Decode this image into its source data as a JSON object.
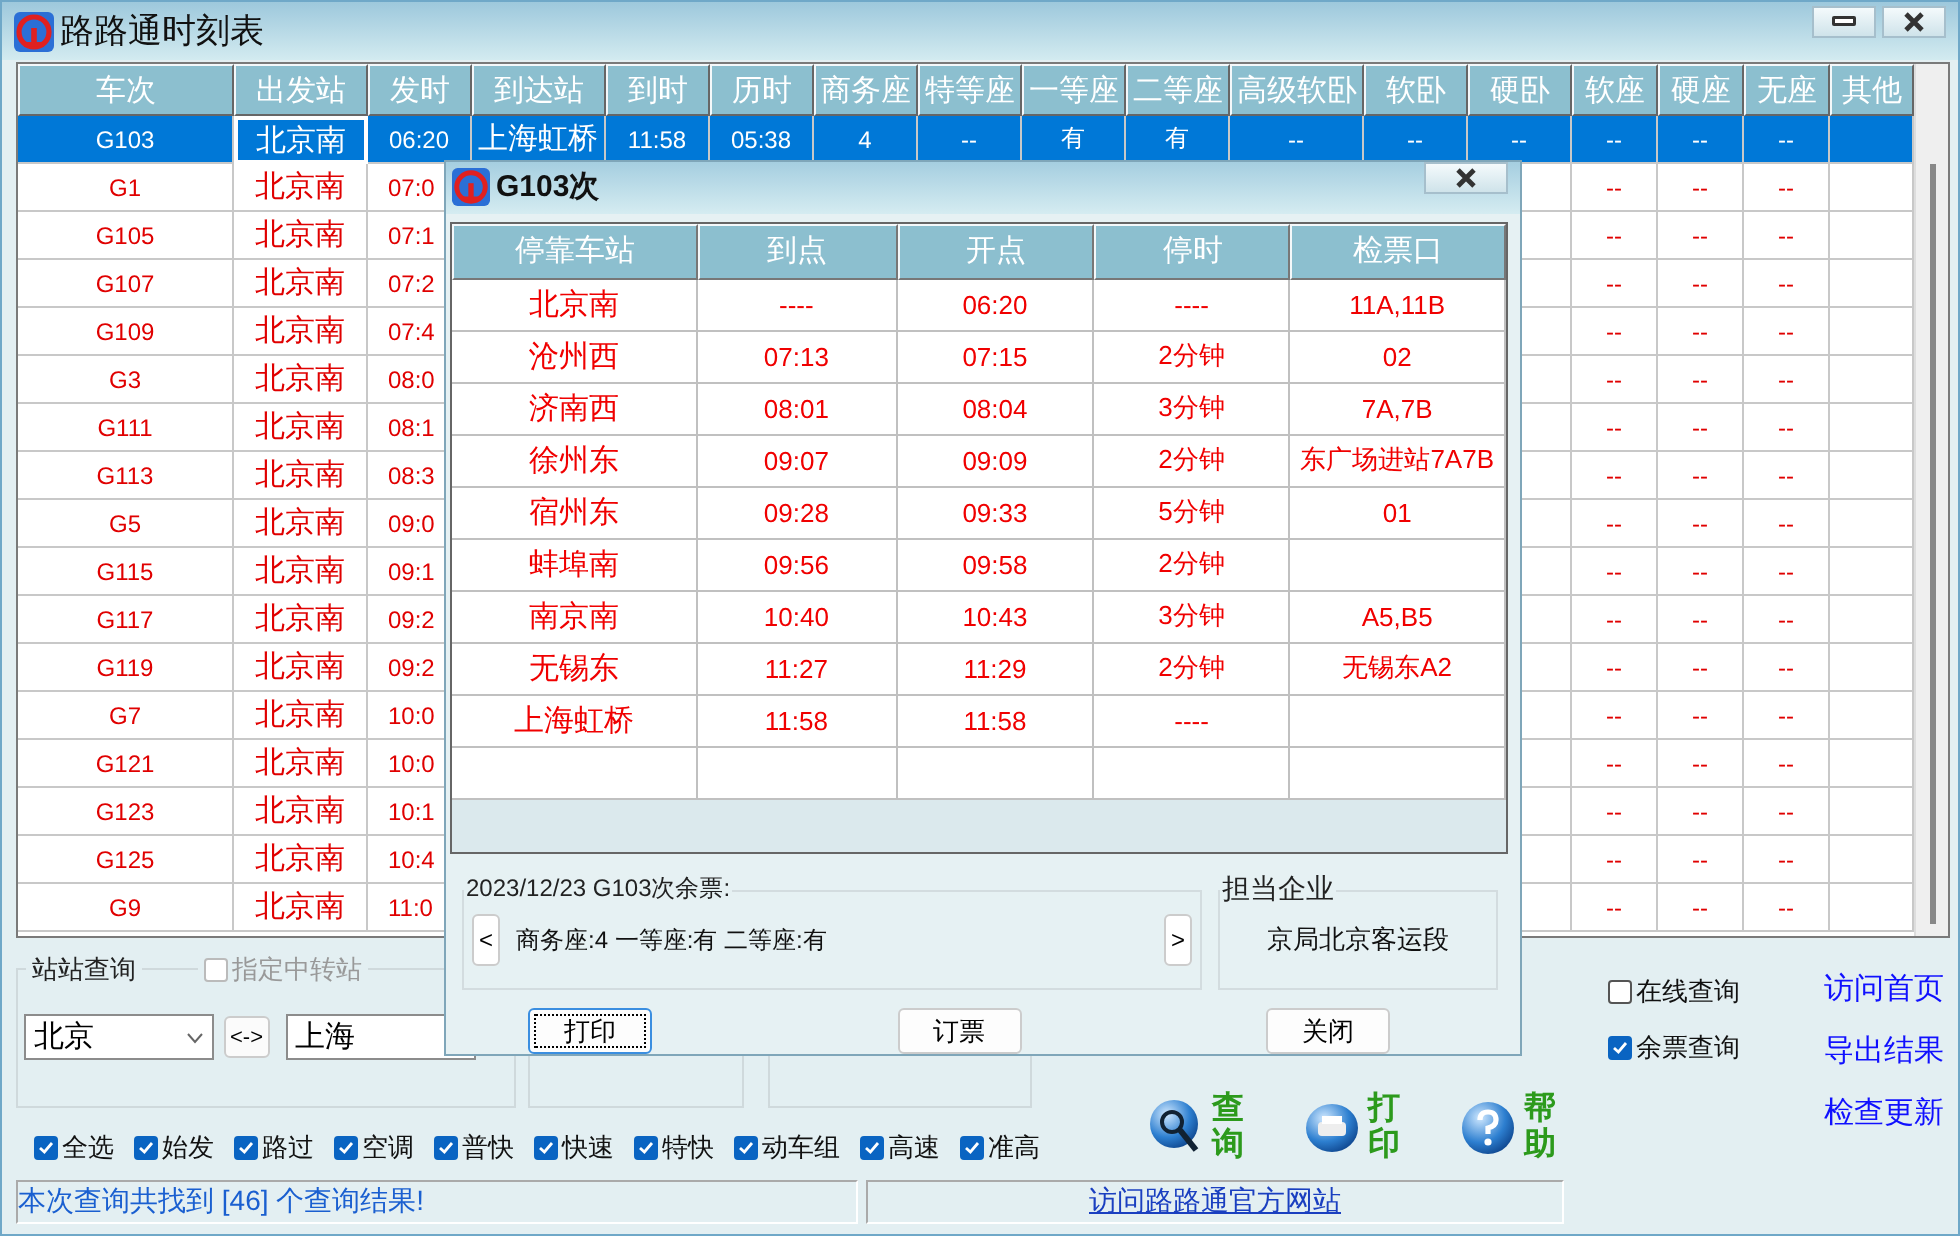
{
  "window": {
    "title": "路路通时刻表",
    "buttons": [
      {
        "kind": "minimize"
      },
      {
        "kind": "close"
      }
    ]
  },
  "table": {
    "columns": [
      "车次",
      "出发站",
      "发时",
      "到达站",
      "到时",
      "历时",
      "商务座",
      "特等座",
      "一等座",
      "二等座",
      "高级软卧",
      "软卧",
      "硬卧",
      "软座",
      "硬座",
      "无座",
      "其他"
    ],
    "rows": [
      {
        "selected": true,
        "lead": [
          "G103",
          "北京南",
          "06:20",
          "上海虹桥",
          "11:58",
          "05:38",
          "4",
          "--",
          "有",
          "有",
          "--",
          "--",
          "--"
        ],
        "tail": [
          "--",
          "--",
          "--"
        ]
      },
      {
        "selected": false,
        "lead": [
          "G1",
          "北京南",
          "07:0"
        ],
        "tail": [
          "--",
          "--",
          "--"
        ]
      },
      {
        "selected": false,
        "lead": [
          "G105",
          "北京南",
          "07:1"
        ],
        "tail": [
          "--",
          "--",
          "--"
        ]
      },
      {
        "selected": false,
        "lead": [
          "G107",
          "北京南",
          "07:2"
        ],
        "tail": [
          "--",
          "--",
          "--"
        ]
      },
      {
        "selected": false,
        "lead": [
          "G109",
          "北京南",
          "07:4"
        ],
        "tail": [
          "--",
          "--",
          "--"
        ]
      },
      {
        "selected": false,
        "lead": [
          "G3",
          "北京南",
          "08:0"
        ],
        "tail": [
          "--",
          "--",
          "--"
        ]
      },
      {
        "selected": false,
        "lead": [
          "G111",
          "北京南",
          "08:1"
        ],
        "tail": [
          "--",
          "--",
          "--"
        ]
      },
      {
        "selected": false,
        "lead": [
          "G113",
          "北京南",
          "08:3"
        ],
        "tail": [
          "--",
          "--",
          "--"
        ]
      },
      {
        "selected": false,
        "lead": [
          "G5",
          "北京南",
          "09:0"
        ],
        "tail": [
          "--",
          "--",
          "--"
        ]
      },
      {
        "selected": false,
        "lead": [
          "G115",
          "北京南",
          "09:1"
        ],
        "tail": [
          "--",
          "--",
          "--"
        ]
      },
      {
        "selected": false,
        "lead": [
          "G117",
          "北京南",
          "09:2"
        ],
        "tail": [
          "--",
          "--",
          "--"
        ]
      },
      {
        "selected": false,
        "lead": [
          "G119",
          "北京南",
          "09:2"
        ],
        "tail": [
          "--",
          "--",
          "--"
        ]
      },
      {
        "selected": false,
        "lead": [
          "G7",
          "北京南",
          "10:0"
        ],
        "tail": [
          "--",
          "--",
          "--"
        ]
      },
      {
        "selected": false,
        "lead": [
          "G121",
          "北京南",
          "10:0"
        ],
        "tail": [
          "--",
          "--",
          "--"
        ]
      },
      {
        "selected": false,
        "lead": [
          "G123",
          "北京南",
          "10:1"
        ],
        "tail": [
          "--",
          "--",
          "--"
        ]
      },
      {
        "selected": false,
        "lead": [
          "G125",
          "北京南",
          "10:4"
        ],
        "tail": [
          "--",
          "--",
          "--"
        ]
      },
      {
        "selected": false,
        "lead": [
          "G9",
          "北京南",
          "11:0"
        ],
        "tail": [
          "--",
          "--",
          "--"
        ]
      }
    ]
  },
  "station_query": {
    "title": "站站查询",
    "transfer": {
      "label": "指定中转站",
      "checked": false,
      "disabled": true
    },
    "from": "北京",
    "swap": "<->",
    "to": "上海"
  },
  "filters": [
    {
      "label": "全选",
      "checked": true
    },
    {
      "label": "始发",
      "checked": true
    },
    {
      "label": "路过",
      "checked": true
    },
    {
      "label": "空调",
      "checked": true
    },
    {
      "label": "普快",
      "checked": true
    },
    {
      "label": "快速",
      "checked": true
    },
    {
      "label": "特快",
      "checked": true
    },
    {
      "label": "动车组",
      "checked": true
    },
    {
      "label": "高速",
      "checked": true
    },
    {
      "label": "准高",
      "checked": true
    }
  ],
  "actions": [
    {
      "kind": "search",
      "label": "查询"
    },
    {
      "kind": "print",
      "label": "打印"
    },
    {
      "kind": "help",
      "label": "帮助"
    }
  ],
  "options": [
    {
      "label": "在线查询",
      "checked": false
    },
    {
      "label": "余票查询",
      "checked": true
    }
  ],
  "links": [
    "访问首页",
    "导出结果",
    "检查更新"
  ],
  "status_bar": {
    "message": "本次查询共找到 [46] 个查询结果!",
    "link": "访问路路通官方网站"
  },
  "dialog": {
    "title": "G103次",
    "columns": [
      "停靠车站",
      "到点",
      "开点",
      "停时",
      "检票口"
    ],
    "stops": [
      {
        "station": "北京南",
        "arrive": "----",
        "depart": "06:20",
        "stop": "----",
        "gate": "11A,11B"
      },
      {
        "station": "沧州西",
        "arrive": "07:13",
        "depart": "07:15",
        "stop": "2分钟",
        "gate": "02"
      },
      {
        "station": "济南西",
        "arrive": "08:01",
        "depart": "08:04",
        "stop": "3分钟",
        "gate": "7A,7B"
      },
      {
        "station": "徐州东",
        "arrive": "09:07",
        "depart": "09:09",
        "stop": "2分钟",
        "gate": "东广场进站7A7B"
      },
      {
        "station": "宿州东",
        "arrive": "09:28",
        "depart": "09:33",
        "stop": "5分钟",
        "gate": "01"
      },
      {
        "station": "蚌埠南",
        "arrive": "09:56",
        "depart": "09:58",
        "stop": "2分钟"
      },
      {
        "station": "南京南",
        "arrive": "10:40",
        "depart": "10:43",
        "stop": "3分钟",
        "gate": "A5,B5"
      },
      {
        "station": "无锡东",
        "arrive": "11:27",
        "depart": "11:29",
        "stop": "2分钟",
        "gate": "无锡东A2"
      },
      {
        "station": "上海虹桥",
        "arrive": "11:58",
        "depart": "11:58",
        "stop": "----"
      }
    ],
    "tickets": {
      "title": "2023/12/23 G103次余票:",
      "prev": "<",
      "next": ">",
      "text": "商务座:4 一等座:有 二等座:有"
    },
    "operator": {
      "title": "担当企业",
      "name": "京局北京客运段"
    },
    "buttons": [
      {
        "label": "打印",
        "focused": true
      },
      {
        "label": "订票",
        "focused": false
      },
      {
        "label": "关闭",
        "focused": false
      }
    ]
  }
}
